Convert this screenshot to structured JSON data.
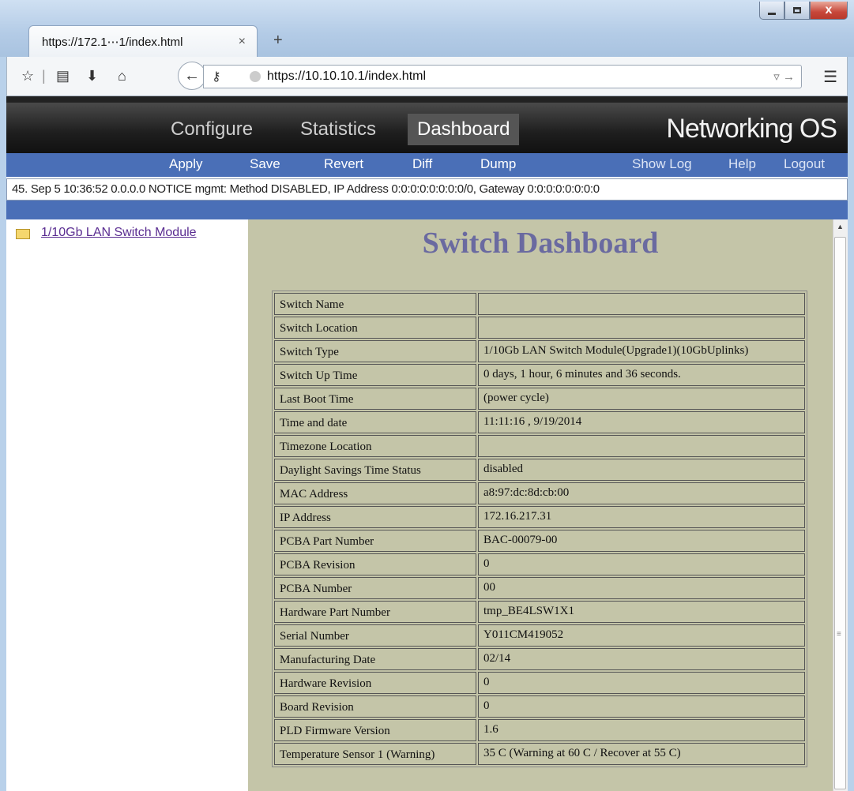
{
  "browser": {
    "tab_title": "https://172.1⋯1/index.html",
    "tab_close": "×",
    "new_tab": "+",
    "url": "https://10.10.10.1/index.html"
  },
  "header": {
    "nav": [
      "Configure",
      "Statistics",
      "Dashboard"
    ],
    "active_nav": "Dashboard",
    "brand": "Networking OS"
  },
  "actions": {
    "left": [
      "Apply",
      "Save",
      "Revert",
      "Diff",
      "Dump"
    ],
    "right": [
      "Show Log",
      "Help",
      "Logout"
    ]
  },
  "log_line": "45. Sep  5 10:36:52 0.0.0.0 NOTICE  mgmt: Method DISABLED, IP Address 0:0:0:0:0:0:0:0/0, Gateway 0:0:0:0:0:0:0:0",
  "tree": {
    "item": "1/10Gb LAN Switch Module"
  },
  "dashboard": {
    "title": "Switch Dashboard",
    "rows": [
      [
        "Switch Name",
        ""
      ],
      [
        "Switch Location",
        ""
      ],
      [
        "Switch Type",
        "1/10Gb LAN Switch Module(Upgrade1)(10GbUplinks)"
      ],
      [
        "Switch Up Time",
        "0 days, 1 hour, 6 minutes and 36 seconds."
      ],
      [
        "Last Boot Time",
        " (power cycle)"
      ],
      [
        "Time and date",
        "11:11:16 , 9/19/2014"
      ],
      [
        "Timezone Location",
        ""
      ],
      [
        "Daylight Savings Time Status",
        "disabled"
      ],
      [
        "MAC Address",
        "a8:97:dc:8d:cb:00"
      ],
      [
        "IP Address",
        "172.16.217.31"
      ],
      [
        "PCBA Part Number",
        "BAC-00079-00"
      ],
      [
        "PCBA Revision",
        "0"
      ],
      [
        "PCBA Number",
        "00"
      ],
      [
        "Hardware Part Number",
        "tmp_BE4LSW1X1"
      ],
      [
        "Serial Number",
        "Y011CM419052"
      ],
      [
        "Manufacturing Date",
        "02/14"
      ],
      [
        "Hardware Revision",
        "0"
      ],
      [
        "Board Revision",
        "0"
      ],
      [
        "PLD Firmware Version",
        "1.6"
      ],
      [
        "Temperature Sensor 1 (Warning)",
        "35 C (Warning at 60 C / Recover at 55 C)"
      ]
    ]
  },
  "colors": {
    "action_bar": "#4a6fb7",
    "content_bg": "#c4c5a8",
    "title": "#6a6aa0"
  }
}
